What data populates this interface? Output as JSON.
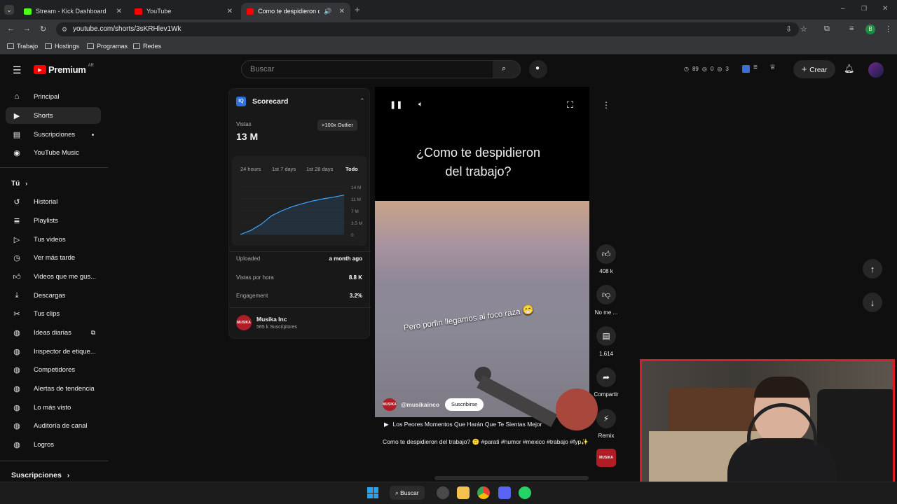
{
  "browser": {
    "tabs": [
      {
        "label": "Stream - Kick Dashboard"
      },
      {
        "label": "YouTube"
      },
      {
        "label": "Como te despidieron del tr"
      }
    ],
    "url": "youtube.com/shorts/3sKRHlev1Wk",
    "bookmarks": [
      "Trabajo",
      "Hostings",
      "Programas",
      "Redes"
    ],
    "profile_initial": "B"
  },
  "youtube": {
    "logo": "Premium",
    "region": "AR",
    "search_placeholder": "Buscar",
    "stats": {
      "a": "89",
      "b": "0",
      "c": "3"
    },
    "create_label": "Crear"
  },
  "sidebar": {
    "main": [
      {
        "label": "Principal",
        "icon": "home-icon"
      },
      {
        "label": "Shorts",
        "icon": "shorts-icon"
      },
      {
        "label": "Suscripciones",
        "icon": "subscriptions-icon"
      },
      {
        "label": "YouTube Music",
        "icon": "music-icon"
      }
    ],
    "you_label": "Tú",
    "you": [
      {
        "label": "Historial"
      },
      {
        "label": "Playlists"
      },
      {
        "label": "Tus videos"
      },
      {
        "label": "Ver más tarde"
      },
      {
        "label": "Videos que me gus..."
      },
      {
        "label": "Descargas"
      },
      {
        "label": "Tus clips"
      },
      {
        "label": "Ideas diarias"
      },
      {
        "label": "Inspector de etique..."
      },
      {
        "label": "Competidores"
      },
      {
        "label": "Alertas de tendencia"
      },
      {
        "label": "Lo más visto"
      },
      {
        "label": "Auditoría de canal"
      },
      {
        "label": "Logros"
      }
    ],
    "subs_label": "Suscripciones"
  },
  "scorecard": {
    "title": "Scorecard",
    "views_label": "Vistas",
    "views_value": "13 M",
    "outlier": ">100x Outlier",
    "ranges": [
      "24 hours",
      "1st 7 days",
      "1st 28 days",
      "Todo"
    ],
    "y_ticks": [
      "14 M",
      "11 M",
      "7 M",
      "3.5 M",
      "0"
    ],
    "rows": [
      {
        "label": "Uploaded",
        "value": "a month ago"
      },
      {
        "label": "Vistas por hora",
        "value": "8.8 K"
      },
      {
        "label": "Engagement",
        "value": "3.2%"
      }
    ],
    "channel_name": "Musika Inc",
    "channel_subs": "565 k Suscriptores"
  },
  "chart_data": {
    "type": "line",
    "x": [
      0,
      1,
      2,
      3,
      4,
      5,
      6,
      7,
      8,
      9,
      10
    ],
    "values": [
      0,
      1.2,
      3.0,
      5.5,
      7.0,
      8.2,
      9.1,
      9.9,
      10.5,
      11.0,
      11.6
    ],
    "ylim": [
      0,
      14
    ],
    "y_ticks": [
      "14 M",
      "11 M",
      "7 M",
      "3.5 M",
      "0"
    ],
    "color": "#3ea6ff"
  },
  "video": {
    "title_line1": "¿Como te despidieron",
    "title_line2": "del trabajo?",
    "caption": "Pero porfin llegamos al foco raza",
    "handle": "@musikainco",
    "subscribe": "Suscribirse",
    "playlist": "Los Peores Momentos Que Harán Que Te Sientas Mejor",
    "description": "Como te despidieron del trabajo? 🙃 #parati #humor #mexico #trabajo #fyp✨"
  },
  "actions": {
    "likes": "408 k",
    "dislike": "No me ...",
    "comments": "1,614",
    "share": "Compartir",
    "remix": "Remix"
  },
  "taskbar": {
    "search": "Buscar"
  }
}
